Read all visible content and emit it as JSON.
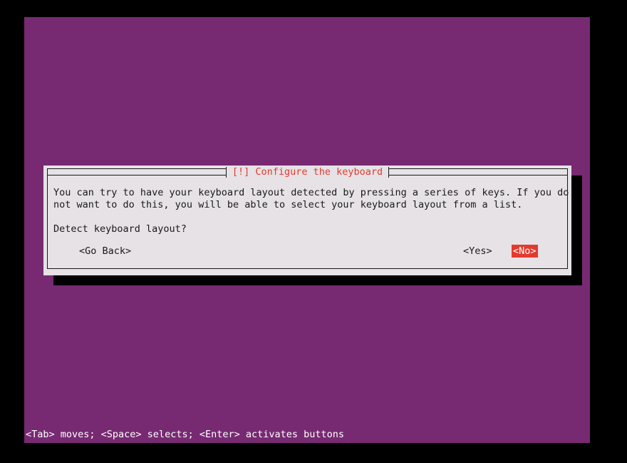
{
  "screen": {
    "background_color": "#000000",
    "console_color": "#772a72"
  },
  "dialog": {
    "title": "[!] Configure the keyboard",
    "title_color": "#e33a2e",
    "background_color": "#e6e2e6",
    "border_color": "#1a1a1a",
    "paragraph": "You can try to have your keyboard layout detected by pressing a series of keys. If you do\nnot want to do this, you will be able to select your keyboard layout from a list.",
    "question": "Detect keyboard layout?",
    "buttons": {
      "go_back": "<Go Back>",
      "yes": "<Yes>",
      "no": "<No>",
      "selected": "<No>",
      "selected_bg": "#e33a2e",
      "selected_fg": "#ffffff"
    }
  },
  "footer": {
    "hint": "<Tab> moves; <Space> selects; <Enter> activates buttons",
    "background_color": "#772a72",
    "text_color": "#ffffff"
  }
}
